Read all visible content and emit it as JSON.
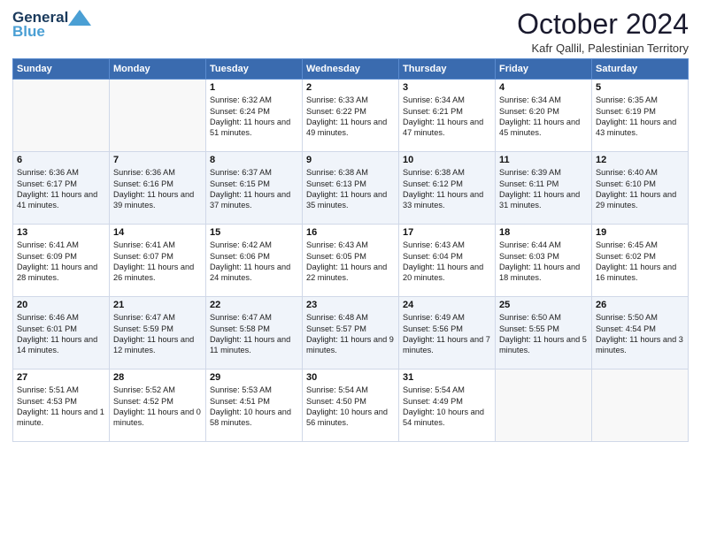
{
  "header": {
    "title": "October 2024",
    "subtitle": "Kafr Qallil, Palestinian Territory"
  },
  "days": [
    "Sunday",
    "Monday",
    "Tuesday",
    "Wednesday",
    "Thursday",
    "Friday",
    "Saturday"
  ],
  "weeks": [
    [
      {
        "num": "",
        "info": ""
      },
      {
        "num": "",
        "info": ""
      },
      {
        "num": "1",
        "info": "Sunrise: 6:32 AM\nSunset: 6:24 PM\nDaylight: 11 hours and 51 minutes."
      },
      {
        "num": "2",
        "info": "Sunrise: 6:33 AM\nSunset: 6:22 PM\nDaylight: 11 hours and 49 minutes."
      },
      {
        "num": "3",
        "info": "Sunrise: 6:34 AM\nSunset: 6:21 PM\nDaylight: 11 hours and 47 minutes."
      },
      {
        "num": "4",
        "info": "Sunrise: 6:34 AM\nSunset: 6:20 PM\nDaylight: 11 hours and 45 minutes."
      },
      {
        "num": "5",
        "info": "Sunrise: 6:35 AM\nSunset: 6:19 PM\nDaylight: 11 hours and 43 minutes."
      }
    ],
    [
      {
        "num": "6",
        "info": "Sunrise: 6:36 AM\nSunset: 6:17 PM\nDaylight: 11 hours and 41 minutes."
      },
      {
        "num": "7",
        "info": "Sunrise: 6:36 AM\nSunset: 6:16 PM\nDaylight: 11 hours and 39 minutes."
      },
      {
        "num": "8",
        "info": "Sunrise: 6:37 AM\nSunset: 6:15 PM\nDaylight: 11 hours and 37 minutes."
      },
      {
        "num": "9",
        "info": "Sunrise: 6:38 AM\nSunset: 6:13 PM\nDaylight: 11 hours and 35 minutes."
      },
      {
        "num": "10",
        "info": "Sunrise: 6:38 AM\nSunset: 6:12 PM\nDaylight: 11 hours and 33 minutes."
      },
      {
        "num": "11",
        "info": "Sunrise: 6:39 AM\nSunset: 6:11 PM\nDaylight: 11 hours and 31 minutes."
      },
      {
        "num": "12",
        "info": "Sunrise: 6:40 AM\nSunset: 6:10 PM\nDaylight: 11 hours and 29 minutes."
      }
    ],
    [
      {
        "num": "13",
        "info": "Sunrise: 6:41 AM\nSunset: 6:09 PM\nDaylight: 11 hours and 28 minutes."
      },
      {
        "num": "14",
        "info": "Sunrise: 6:41 AM\nSunset: 6:07 PM\nDaylight: 11 hours and 26 minutes."
      },
      {
        "num": "15",
        "info": "Sunrise: 6:42 AM\nSunset: 6:06 PM\nDaylight: 11 hours and 24 minutes."
      },
      {
        "num": "16",
        "info": "Sunrise: 6:43 AM\nSunset: 6:05 PM\nDaylight: 11 hours and 22 minutes."
      },
      {
        "num": "17",
        "info": "Sunrise: 6:43 AM\nSunset: 6:04 PM\nDaylight: 11 hours and 20 minutes."
      },
      {
        "num": "18",
        "info": "Sunrise: 6:44 AM\nSunset: 6:03 PM\nDaylight: 11 hours and 18 minutes."
      },
      {
        "num": "19",
        "info": "Sunrise: 6:45 AM\nSunset: 6:02 PM\nDaylight: 11 hours and 16 minutes."
      }
    ],
    [
      {
        "num": "20",
        "info": "Sunrise: 6:46 AM\nSunset: 6:01 PM\nDaylight: 11 hours and 14 minutes."
      },
      {
        "num": "21",
        "info": "Sunrise: 6:47 AM\nSunset: 5:59 PM\nDaylight: 11 hours and 12 minutes."
      },
      {
        "num": "22",
        "info": "Sunrise: 6:47 AM\nSunset: 5:58 PM\nDaylight: 11 hours and 11 minutes."
      },
      {
        "num": "23",
        "info": "Sunrise: 6:48 AM\nSunset: 5:57 PM\nDaylight: 11 hours and 9 minutes."
      },
      {
        "num": "24",
        "info": "Sunrise: 6:49 AM\nSunset: 5:56 PM\nDaylight: 11 hours and 7 minutes."
      },
      {
        "num": "25",
        "info": "Sunrise: 6:50 AM\nSunset: 5:55 PM\nDaylight: 11 hours and 5 minutes."
      },
      {
        "num": "26",
        "info": "Sunrise: 5:50 AM\nSunset: 4:54 PM\nDaylight: 11 hours and 3 minutes."
      }
    ],
    [
      {
        "num": "27",
        "info": "Sunrise: 5:51 AM\nSunset: 4:53 PM\nDaylight: 11 hours and 1 minute."
      },
      {
        "num": "28",
        "info": "Sunrise: 5:52 AM\nSunset: 4:52 PM\nDaylight: 11 hours and 0 minutes."
      },
      {
        "num": "29",
        "info": "Sunrise: 5:53 AM\nSunset: 4:51 PM\nDaylight: 10 hours and 58 minutes."
      },
      {
        "num": "30",
        "info": "Sunrise: 5:54 AM\nSunset: 4:50 PM\nDaylight: 10 hours and 56 minutes."
      },
      {
        "num": "31",
        "info": "Sunrise: 5:54 AM\nSunset: 4:49 PM\nDaylight: 10 hours and 54 minutes."
      },
      {
        "num": "",
        "info": ""
      },
      {
        "num": "",
        "info": ""
      }
    ]
  ]
}
